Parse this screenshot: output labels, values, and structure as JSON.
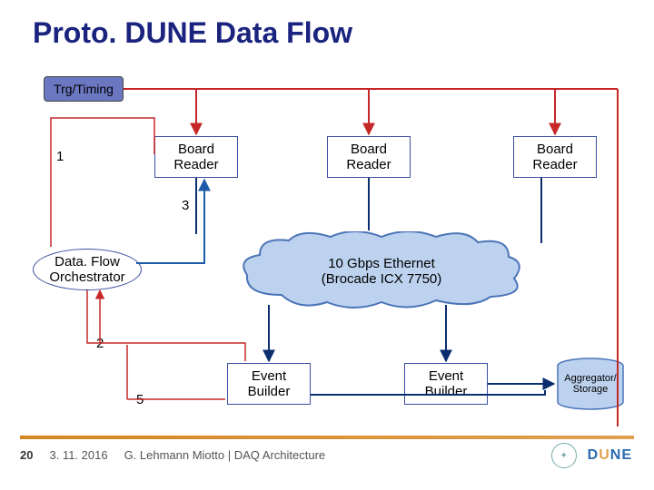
{
  "title": "Proto. DUNE Data Flow",
  "blocks": {
    "trg": "Trg/Timing",
    "board_reader": "Board\nReader",
    "dfo": "Data. Flow\nOrchestrator",
    "ethernet": "10 Gbps Ethernet\n(Brocade ICX 7750)",
    "event_builder": "Event\nBuilder",
    "storage": "Aggregator/\nStorage"
  },
  "numbers": {
    "n1": "1",
    "n2": "2",
    "n3": "3",
    "n5": "5"
  },
  "footer": {
    "page": "20",
    "date": "3. 11. 2016",
    "credit": "G. Lehmann Miotto | DAQ Architecture"
  },
  "logos": {
    "dune_d": "D",
    "dune_u": "U",
    "dune_ne": "NE"
  }
}
